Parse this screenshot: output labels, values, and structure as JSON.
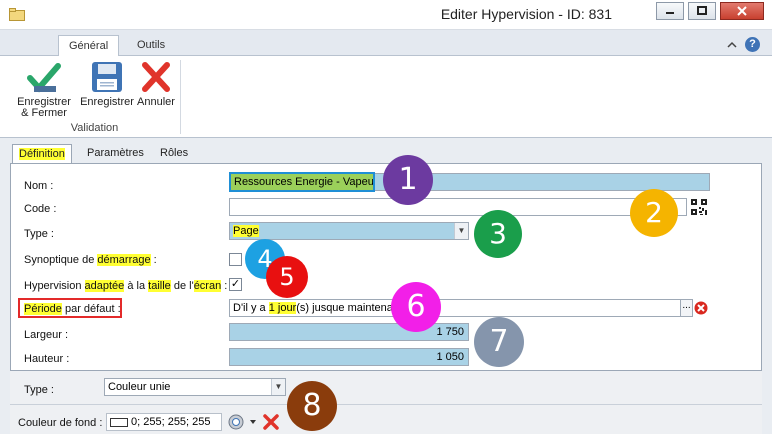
{
  "window": {
    "title": "Editer Hypervision - ID: 831"
  },
  "ribbon": {
    "tabs": [
      "Général",
      "Outils"
    ],
    "buttons": {
      "save_close": "Enregistrer & Fermer",
      "save": "Enregistrer",
      "cancel": "Annuler"
    },
    "group_label": "Validation"
  },
  "content_tabs": [
    "Définition",
    "Paramètres",
    "Rôles"
  ],
  "form": {
    "nom_label": "Nom :",
    "nom_value": "Ressources Energie - Vapeur",
    "code_label": "Code :",
    "code_value": "",
    "type_label": "Type :",
    "type_value": "Page",
    "synoptique_label": {
      "before": "Synoptique de ",
      "hl": "démarrage",
      "after": " :"
    },
    "synoptique_checked": false,
    "hyper_label": {
      "a": "Hypervision ",
      "b": "adaptée",
      "c": " à la ",
      "d": "taille",
      "e": " de l'",
      "f": "écran",
      "g": " :"
    },
    "hyper_checked": true,
    "periode_label": {
      "hl": "Période",
      "after": " par défaut :"
    },
    "periode_value": {
      "before": "D'il y a ",
      "hl": "1 jour",
      "after": "(s) jusque maintenant"
    },
    "largeur_label": "Largeur :",
    "largeur_value": "1 750",
    "hauteur_label": "Hauteur :",
    "hauteur_value": "1 050"
  },
  "lower": {
    "type_label": "Type :",
    "type_value": "Couleur unie",
    "fond_label": "Couleur de fond :",
    "fond_value": "0; 255; 255; 255"
  },
  "callouts": [
    "1",
    "2",
    "3",
    "4",
    "5",
    "6",
    "7",
    "8"
  ],
  "colors": {
    "c1": "#6c3aa0",
    "c2": "#f5b400",
    "c3": "#1a9e4b",
    "c4": "#1da1e2",
    "c5": "#e81010",
    "c6": "#f21fe8",
    "c7": "#8595ac",
    "c8": "#8a3c0c",
    "highlight": "#ffff33",
    "field_blue": "#a9d2e6"
  }
}
